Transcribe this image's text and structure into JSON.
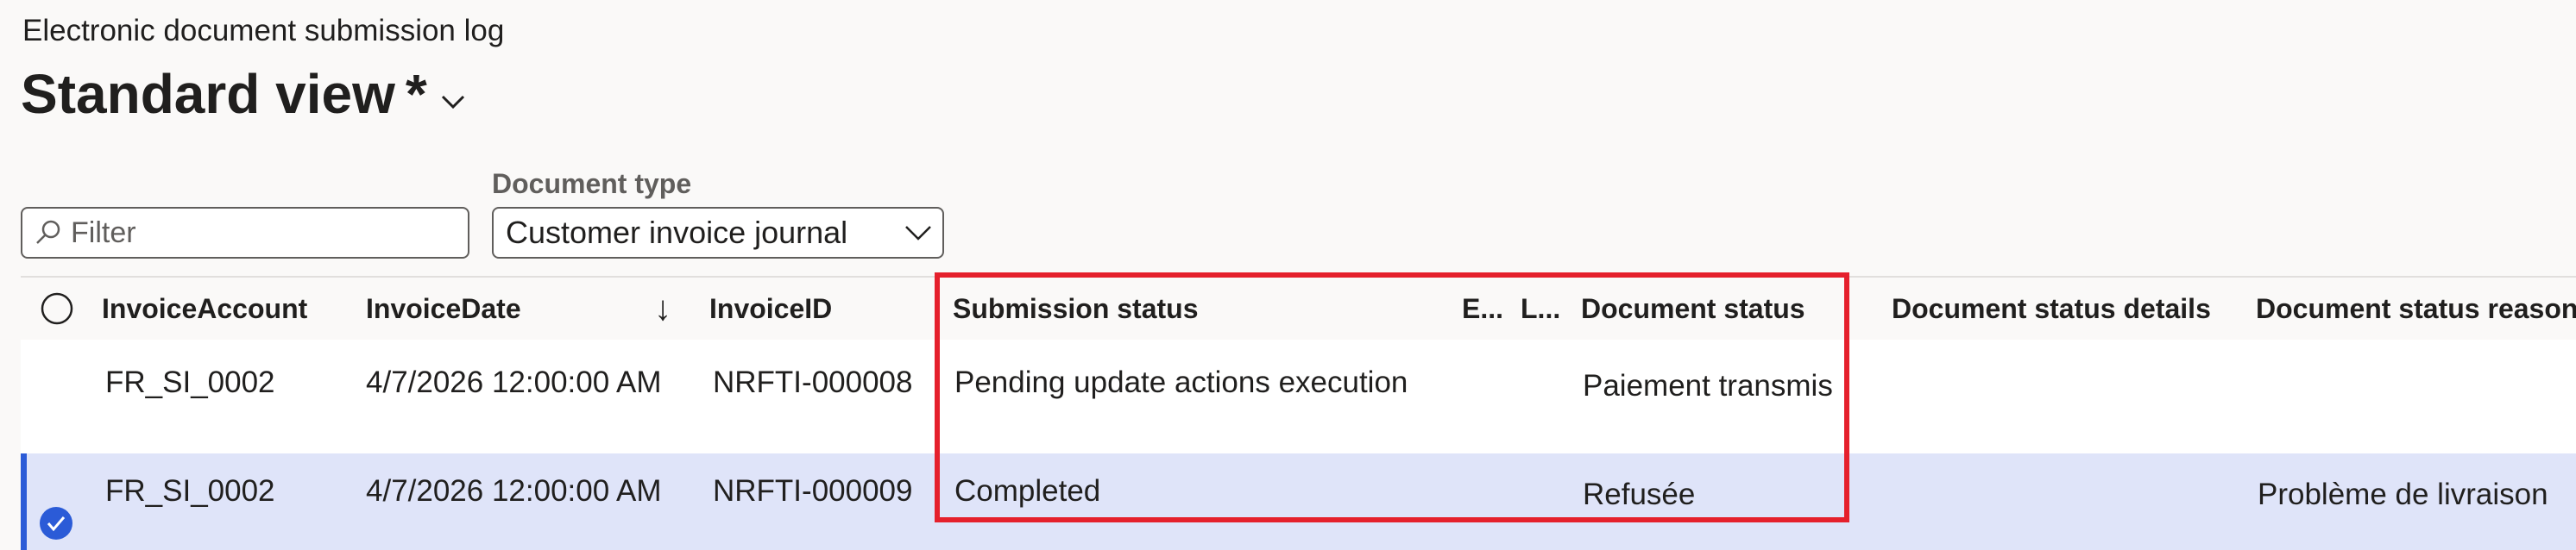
{
  "page": {
    "subtitle": "Electronic document submission log",
    "view_name": "Standard view",
    "view_modified_marker": "*"
  },
  "filters": {
    "filter_placeholder": "Filter",
    "document_type_label": "Document type",
    "document_type_value": "Customer invoice journal"
  },
  "grid": {
    "columns": {
      "invoice_account": "InvoiceAccount",
      "invoice_date": "InvoiceDate",
      "invoice_id": "InvoiceID",
      "submission_status": "Submission status",
      "col_e": "E...",
      "col_l": "L...",
      "document_status": "Document status",
      "document_status_details": "Document status details",
      "document_status_reason": "Document status reason"
    },
    "sort_indicator": "↓",
    "rows": [
      {
        "invoice_account": "FR_SI_0002",
        "invoice_date": "4/7/2026 12:00:00 AM",
        "invoice_id": "NRFTI-000008",
        "submission_status": "Pending update actions execution",
        "document_status": "Paiement transmis",
        "document_status_details": "",
        "document_status_reason": "",
        "selected": false
      },
      {
        "invoice_account": "FR_SI_0002",
        "invoice_date": "4/7/2026 12:00:00 AM",
        "invoice_id": "NRFTI-000009",
        "submission_status": "Completed",
        "document_status": "Refusée",
        "document_status_details": "",
        "document_status_reason": "Problème de livraison",
        "selected": true
      }
    ]
  },
  "colors": {
    "accent": "#2b5bd7",
    "selected_row": "#dfe4f9",
    "highlight_border": "#e5202c"
  },
  "icons": {
    "view_dropdown": "chevron-down-icon",
    "filter": "search-icon",
    "doc_type_dropdown": "chevron-down-icon",
    "select_all": "radio-circle-icon",
    "row_selected": "checkmark-circle-icon"
  }
}
